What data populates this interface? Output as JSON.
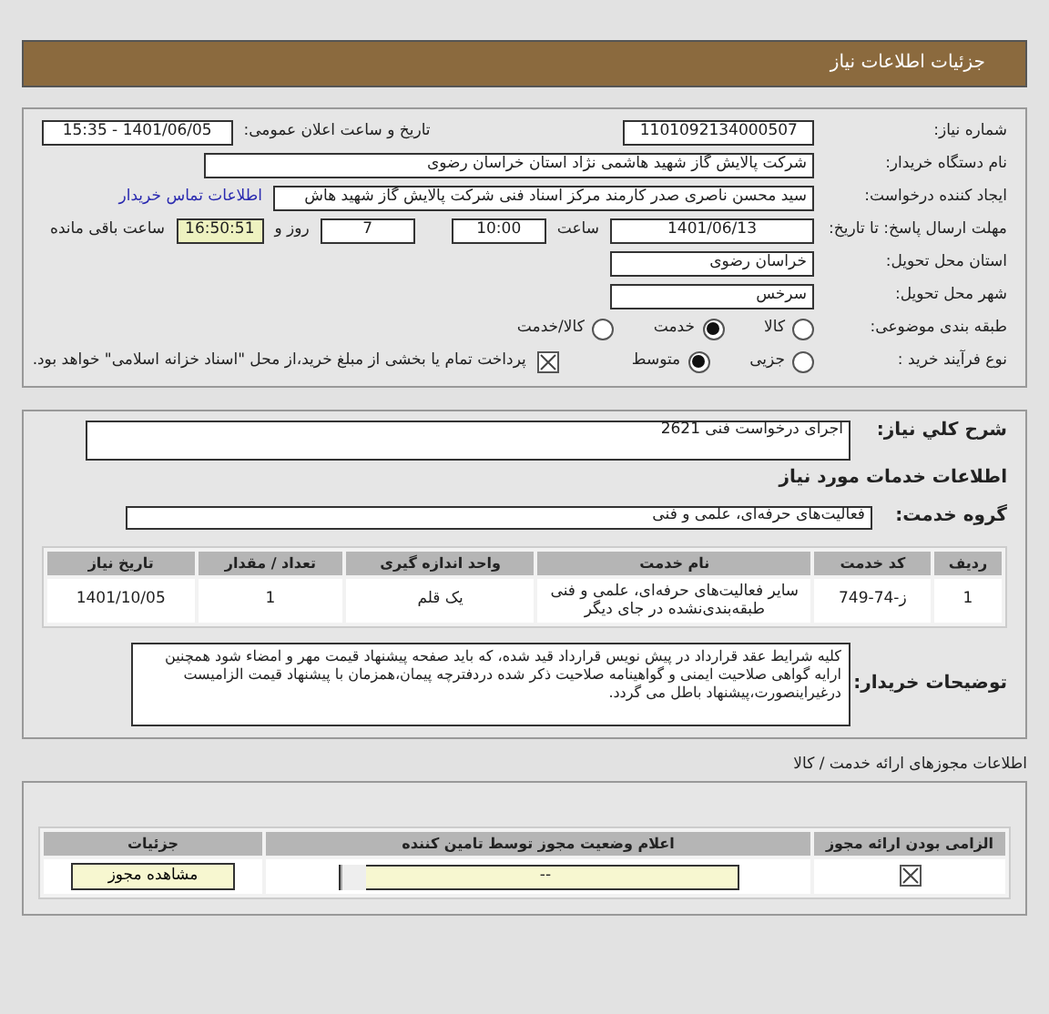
{
  "header": {
    "title": "جزئیات اطلاعات نیاز"
  },
  "need_number": {
    "label": "شماره نیاز:",
    "value": "1101092134000507"
  },
  "announce": {
    "label": "تاریخ و ساعت اعلان عمومی:",
    "value": "1401/06/05 - 15:35"
  },
  "buyer": {
    "label": "نام دستگاه خریدار:",
    "value": "شرکت پالایش گاز شهید هاشمی نژاد   استان خراسان رضوی"
  },
  "requester": {
    "label": "ایجاد کننده درخواست:",
    "value": "سید محسن  ناصری صدر کارمند مرکز اسناد فنی شرکت پالایش گاز شهید هاش",
    "link": "اطلاعات تماس خریدار"
  },
  "deadline": {
    "label": "مهلت ارسال پاسخ: تا تاریخ:",
    "date": "1401/06/13",
    "time_label": "ساعت",
    "time": "10:00",
    "days": "7",
    "days_label": "روز و",
    "remaining": "16:50:51",
    "remaining_label": "ساعت باقی مانده"
  },
  "province": {
    "label": "استان محل تحویل:",
    "value": "خراسان رضوی"
  },
  "city": {
    "label": "شهر محل تحویل:",
    "value": "سرخس"
  },
  "category": {
    "label": "طبقه بندی موضوعی:",
    "options": [
      {
        "label": "کالا",
        "selected": false
      },
      {
        "label": "خدمت",
        "selected": true
      },
      {
        "label": "کالا/خدمت",
        "selected": false
      }
    ]
  },
  "process": {
    "label": "نوع فرآیند خرید :",
    "options": [
      {
        "label": "جزیی",
        "selected": false
      },
      {
        "label": "متوسط",
        "selected": true
      }
    ],
    "payment": {
      "label": "پرداخت تمام یا بخشی از مبلغ خرید،از محل \"اسناد خزانه اسلامی\" خواهد بود.",
      "checked": true
    }
  },
  "summary": {
    "label": "شرح کلي نیاز:",
    "value": "اجرای درخواست فنی 2621"
  },
  "services_title": "اطلاعات خدمات مورد نیاز",
  "service_group": {
    "label": "گروه خدمت:",
    "value": "فعالیت‌های حرفه‌ای، علمی و فنی"
  },
  "table": {
    "columns": [
      "ردیف",
      "کد خدمت",
      "نام خدمت",
      "واحد اندازه گیری",
      "تعداد / مقدار",
      "تاریخ نیاز"
    ],
    "rows": [
      [
        "1",
        "ز-74-749",
        "سایر فعالیت‌های حرفه‌ای، علمی و فنی طبقه‌بندی‌نشده در جای دیگر",
        "یک قلم",
        "1",
        "1401/10/05"
      ]
    ]
  },
  "notes": {
    "label": "توضیحات خریدار:",
    "value": "کلیه شرایط عقد قرارداد در پیش نویس قرارداد قید شده، که باید صفحه پیشنهاد قیمت مهر و امضاء شود همچنین ارایه گواهی صلاحیت ایمنی و گواهینامه صلاحیت ذکر شده دردفترچه پیمان،همزمان با پیشنهاد قیمت الزامیست درغیراینصورت،پیشنهاد باطل می گردد."
  },
  "permits": {
    "title": "اطلاعات مجوزهای ارائه خدمت / کالا",
    "columns": [
      "الزامی بودن ارائه مجوز",
      "اعلام وضعیت مجوز توسط تامین کننده",
      "جزئیات"
    ],
    "rows": [
      {
        "required": true,
        "status": "--",
        "button": "مشاهده مجوز"
      }
    ]
  }
}
